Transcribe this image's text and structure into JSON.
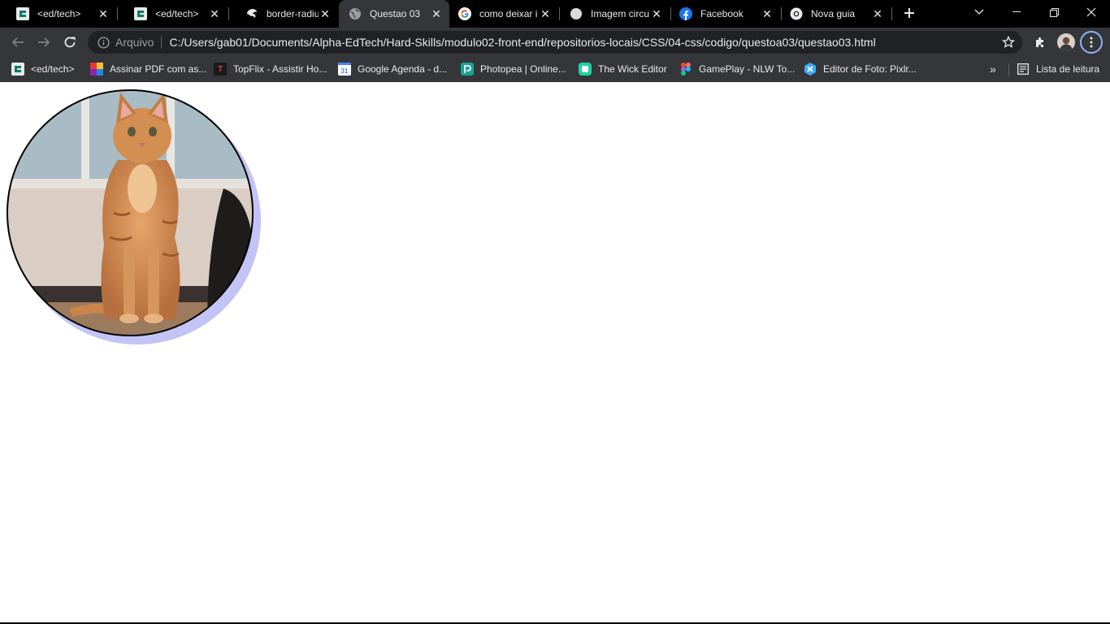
{
  "tabs": [
    {
      "title": "<ed/tech>",
      "icon": "edtech-icon",
      "active": false
    },
    {
      "title": "<ed/tech>",
      "icon": "edtech-icon",
      "active": false
    },
    {
      "title": "border-radius",
      "icon": "mdn-icon",
      "active": false
    },
    {
      "title": "Questao 03",
      "icon": "globe-icon",
      "active": true
    },
    {
      "title": "como deixar i",
      "icon": "google-icon",
      "active": false
    },
    {
      "title": "Imagem circu",
      "icon": "page-icon",
      "active": false
    },
    {
      "title": "Facebook",
      "icon": "facebook-icon",
      "active": false
    },
    {
      "title": "Nova guia",
      "icon": "chrome-icon",
      "active": false
    }
  ],
  "omnibox": {
    "label": "Arquivo",
    "url": "C:/Users/gab01/Documents/Alpha-EdTech/Hard-Skills/modulo02-front-end/repositorios-locais/CSS/04-css/codigo/questoa03/questao03.html"
  },
  "bookmarks": [
    {
      "label": "<ed/tech>",
      "icon": "edtech-icon"
    },
    {
      "label": "Assinar PDF com as...",
      "icon": "pdf-icon"
    },
    {
      "label": "TopFlix - Assistir Ho...",
      "icon": "topflix-icon"
    },
    {
      "label": "Google Agenda - d...",
      "icon": "calendar-icon"
    },
    {
      "label": "Photopea | Online...",
      "icon": "photopea-icon"
    },
    {
      "label": "The Wick Editor",
      "icon": "wick-icon"
    },
    {
      "label": "GamePlay - NLW To...",
      "icon": "figma-icon"
    },
    {
      "label": "Editor de Foto: Pixlr...",
      "icon": "pixlr-icon"
    }
  ],
  "reading_list": {
    "label": "Lista de leitura",
    "icon": "reading-list-icon"
  },
  "page": {
    "image_subject": "orange-tabby-kitten-photo",
    "image_style": "circular image with black border and lavender offset shadow",
    "shadow_color": "#c3c3f5",
    "border_color": "#000000"
  },
  "colors": {
    "tabstrip": "#000000",
    "toolbar": "#35363a",
    "omnibox": "#202124",
    "text": "#e8eaed"
  }
}
